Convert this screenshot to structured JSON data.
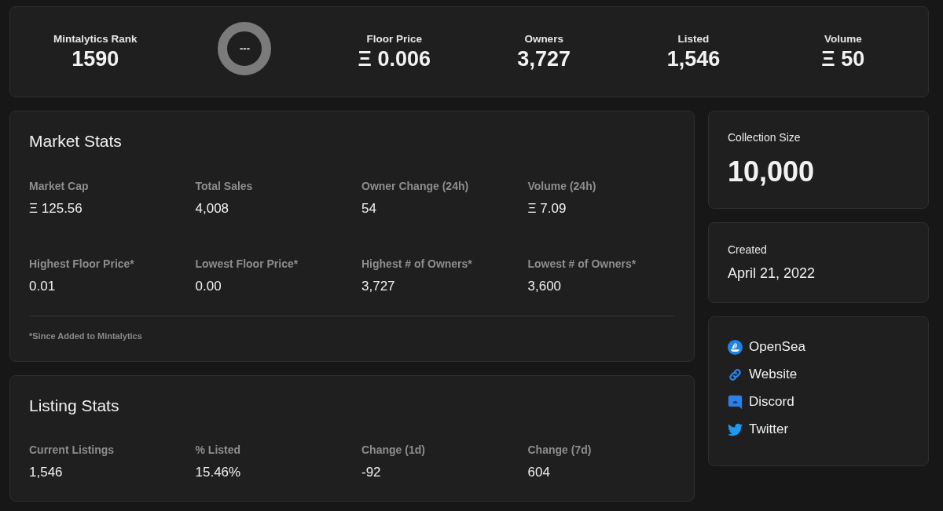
{
  "summary": {
    "items": [
      {
        "kind": "stat",
        "label": "Mintalytics Rank",
        "value": "1590"
      },
      {
        "kind": "ring",
        "text": "---"
      },
      {
        "kind": "stat",
        "label": "Floor Price",
        "value": "Ξ 0.006"
      },
      {
        "kind": "stat",
        "label": "Owners",
        "value": "3,727"
      },
      {
        "kind": "stat",
        "label": "Listed",
        "value": "1,546"
      },
      {
        "kind": "stat",
        "label": "Volume",
        "value": "Ξ 50"
      }
    ]
  },
  "market_stats": {
    "title": "Market Stats",
    "stats": [
      {
        "label": "Market Cap",
        "value": "Ξ 125.56"
      },
      {
        "label": "Total Sales",
        "value": "4,008"
      },
      {
        "label": "Owner Change (24h)",
        "value": "54"
      },
      {
        "label": "Volume (24h)",
        "value": "Ξ 7.09"
      },
      {
        "label": "Highest Floor Price*",
        "value": "0.01"
      },
      {
        "label": "Lowest Floor Price*",
        "value": "0.00"
      },
      {
        "label": "Highest # of Owners*",
        "value": "3,727"
      },
      {
        "label": "Lowest # of Owners*",
        "value": "3,600"
      }
    ],
    "footnote": "*Since Added to Mintalytics"
  },
  "listing_stats": {
    "title": "Listing Stats",
    "stats": [
      {
        "label": "Current Listings",
        "value": "1,546"
      },
      {
        "label": "% Listed",
        "value": "15.46%"
      },
      {
        "label": "Change (1d)",
        "value": "-92"
      },
      {
        "label": "Change (7d)",
        "value": "604"
      }
    ]
  },
  "collection_size": {
    "label": "Collection Size",
    "value": "10,000"
  },
  "created": {
    "label": "Created",
    "value": "April 21, 2022"
  },
  "links": [
    {
      "kind": "opensea",
      "label": "OpenSea"
    },
    {
      "kind": "website",
      "label": "Website"
    },
    {
      "kind": "discord",
      "label": "Discord"
    },
    {
      "kind": "twitter",
      "label": "Twitter"
    }
  ]
}
